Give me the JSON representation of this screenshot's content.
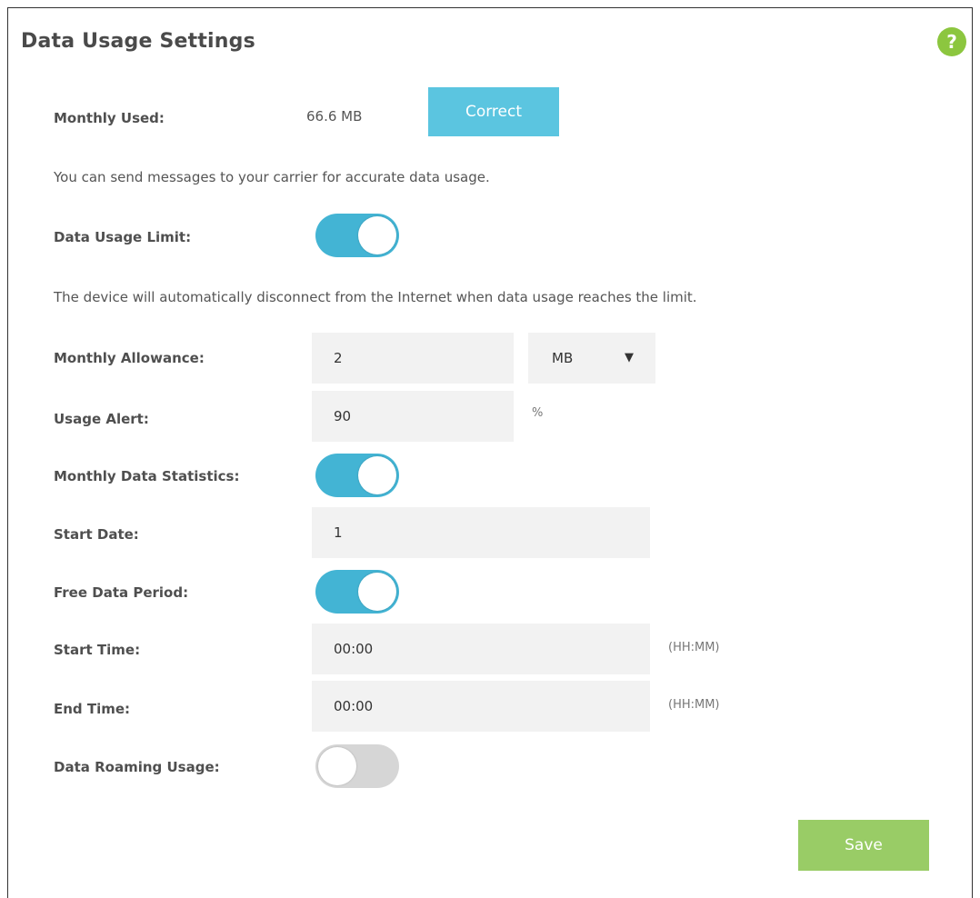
{
  "header": {
    "title": "Data Usage Settings",
    "help_icon": "?"
  },
  "monthly_used": {
    "label": "Monthly Used:",
    "value": "66.6 MB",
    "correct_button": "Correct",
    "note": "You can send messages to your carrier for accurate data usage."
  },
  "data_usage_limit": {
    "label": "Data Usage Limit:",
    "enabled": true,
    "note": "The device will automatically disconnect from the Internet when data usage reaches the limit."
  },
  "monthly_allowance": {
    "label": "Monthly Allowance:",
    "value": "2",
    "unit_selected": "MB"
  },
  "usage_alert": {
    "label": "Usage Alert:",
    "value": "90",
    "unit": "%"
  },
  "monthly_data_statistics": {
    "label": "Monthly Data Statistics:",
    "enabled": true
  },
  "start_date": {
    "label": "Start Date:",
    "value": "1"
  },
  "free_data_period": {
    "label": "Free Data Period:",
    "enabled": true
  },
  "start_time": {
    "label": "Start Time:",
    "value": "00:00",
    "format": "(HH:MM)"
  },
  "end_time": {
    "label": "End Time:",
    "value": "00:00",
    "format": "(HH:MM)"
  },
  "data_roaming_usage": {
    "label": "Data Roaming Usage:",
    "enabled": false
  },
  "footer": {
    "save_button": "Save"
  },
  "colors": {
    "toggle_on": "#43b4d4",
    "toggle_off": "#d6d6d6",
    "correct_button": "#5bc5e0",
    "save_button": "#99cc66",
    "help_icon": "#8cc63f"
  }
}
